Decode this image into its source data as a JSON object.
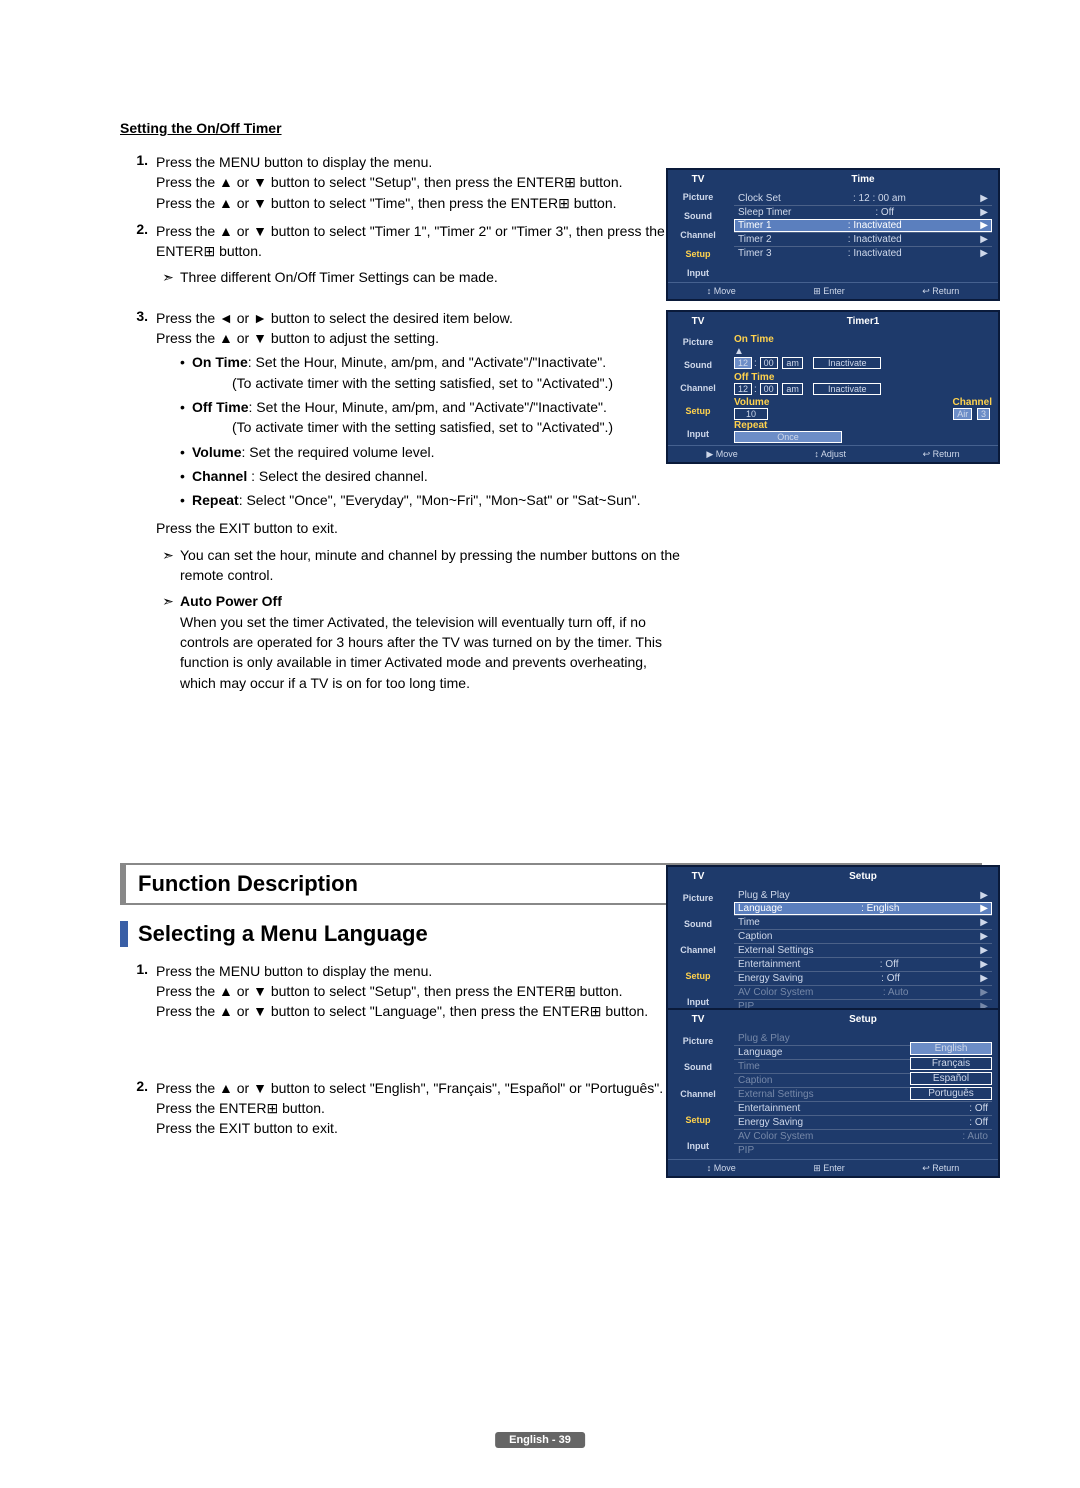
{
  "section1_title": "Setting the On/Off Timer",
  "s1_1a": "Press the MENU button to display the menu.",
  "s1_1b": "Press the ▲ or ▼  button to select \"Setup\", then press the ENTER⊞ button.",
  "s1_1c": "Press the ▲ or ▼ button to select \"Time\", then press the ENTER⊞ button.",
  "s1_2a": "Press the ▲ or ▼ button to select \"Timer 1\", \"Timer 2\" or \"Timer 3\", then press the ENTER⊞ button.",
  "s1_2note": "Three different On/Off Timer Settings can be made.",
  "s1_3a": "Press the ◄ or ► button to select the desired item below.",
  "s1_3b": "Press the ▲ or ▼ button to adjust the setting.",
  "b1_label": "On Time",
  "b1_text": ": Set the Hour, Minute, am/pm, and \"Activate\"/\"Inactivate\".",
  "b1_sub": "(To activate timer with the setting satisfied, set to \"Activated\".)",
  "b2_label": "Off Time",
  "b2_text": ": Set the Hour, Minute, am/pm, and \"Activate\"/\"Inactivate\".",
  "b2_sub": "(To activate timer with the setting satisfied, set to \"Activated\".)",
  "b3_label": "Volume",
  "b3_text": ": Set the required volume level.",
  "b4_label": "Channel",
  "b4_text": " : Select the desired channel.",
  "b5_label": "Repeat",
  "b5_text": ": Select \"Once\", \"Everyday\", \"Mon~Fri\", \"Mon~Sat\" or \"Sat~Sun\".",
  "s1_exit": "Press the EXIT button to exit.",
  "s1_note1": "You can set the hour, minute and channel by pressing the number buttons on the remote control.",
  "apo_title": "Auto Power Off",
  "apo_text": "When you set the timer Activated, the television will eventually turn off, if no controls are operated for 3 hours after the TV was turned on by the timer. This function is only available in timer Activated mode and prevents overheating, which may occur if a TV is on for too long time.",
  "func_box": "Function Description",
  "sub_head": "Selecting a Menu Language",
  "s2_1a": "Press the MENU button to display the menu.",
  "s2_1b": "Press the ▲ or ▼ button to select \"Setup\", then press the ENTER⊞ button.",
  "s2_1c": "Press the ▲ or ▼ button to select \"Language\", then press the ENTER⊞ button.",
  "s2_2a": "Press the ▲ or ▼ button to select \"English\", \"Français\", \"Español\" or \"Português\".",
  "s2_2b": "Press the ENTER⊞ button.",
  "s2_2c": "Press the EXIT button to exit.",
  "footer": "English - 39",
  "osd_tv": "TV",
  "osd_side": [
    "Picture",
    "Sound",
    "Channel",
    "Setup",
    "Input"
  ],
  "osd1_title": "Time",
  "osd1_rows": [
    [
      "Clock Set",
      ": 12 : 00 am"
    ],
    [
      "Sleep Timer",
      ": Off"
    ],
    [
      "Timer 1",
      ": Inactivated"
    ],
    [
      "Timer 2",
      ": Inactivated"
    ],
    [
      "Timer 3",
      ": Inactivated"
    ]
  ],
  "osd_foot": [
    "↕ Move",
    "⊞ Enter",
    "↩ Return"
  ],
  "osd2_title": "Timer1",
  "osd2_on": "On Time",
  "osd2_off": "Off Time",
  "osd2_vol": "Volume",
  "osd2_ch": "Channel",
  "osd2_r": "Repeat",
  "osd2_hr": "12",
  "osd2_mn": "00",
  "osd2_ap": "am",
  "osd2_state": "Inactivate",
  "osd2_vval": "10",
  "osd2_air": "Air",
  "osd2_cn": "3",
  "osd2_once": "Once",
  "osd2_foot": [
    "▶ Move",
    "↕ Adjust",
    "↩ Return"
  ],
  "osd3_title": "Setup",
  "osd3_rows": [
    [
      "Plug & Play",
      ""
    ],
    [
      "Language",
      ": English"
    ],
    [
      "Time",
      ""
    ],
    [
      "Caption",
      ""
    ],
    [
      "External Settings",
      ""
    ],
    [
      "Entertainment",
      ": Off"
    ],
    [
      "Energy Saving",
      ": Off"
    ],
    [
      "AV Color System",
      ": Auto"
    ],
    [
      "PIP",
      ""
    ]
  ],
  "osd4_title": "Setup",
  "osd4_rows": [
    "Plug & Play",
    "Language",
    "Time",
    "Caption",
    "External Settings",
    "Entertainment",
    "Energy Saving",
    "AV Color System",
    "PIP"
  ],
  "osd4_vals": [
    "",
    ":",
    "",
    "",
    "",
    ": Off",
    ": Off",
    ": Auto",
    ""
  ],
  "osd4_opts": [
    "English",
    "Français",
    "Español",
    "Português"
  ]
}
